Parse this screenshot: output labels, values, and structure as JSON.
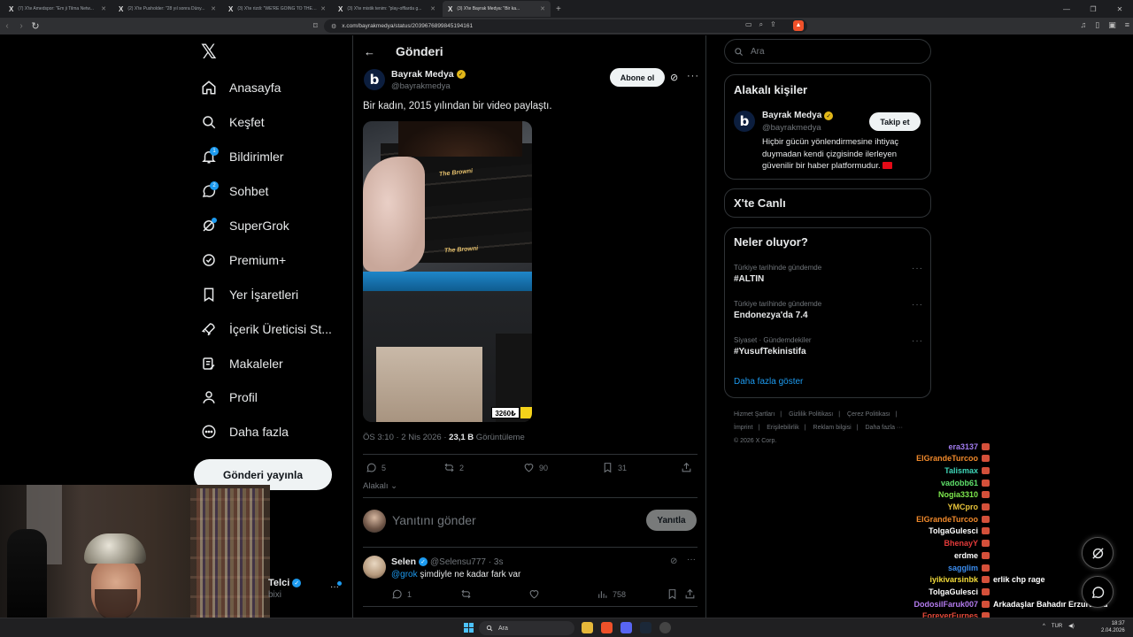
{
  "browser": {
    "tabs": [
      {
        "label": "(7) X'te Amedspor: \"Em ji Tilma Netw..."
      },
      {
        "label": "(2) X'te Pusholder: \"28 yıl sonra Düny..."
      },
      {
        "label": "(3) X'te rizdi: \"WE'RE GOING TO THE W..."
      },
      {
        "label": "(3) X'te mistik tenim: \"play-offlarda g..."
      },
      {
        "label": "(3) X'te Bayrak Medya: \"Bir ka..."
      }
    ],
    "url": "x.com/bayrakmedya/status/2039676899845194161"
  },
  "nav": {
    "items": [
      {
        "label": "Anasayfa",
        "icon": "home-icon"
      },
      {
        "label": "Keşfet",
        "icon": "search-icon"
      },
      {
        "label": "Bildirimler",
        "icon": "bell-icon",
        "badge": "1"
      },
      {
        "label": "Sohbet",
        "icon": "chat-icon",
        "badge": "2"
      },
      {
        "label": "SuperGrok",
        "icon": "grok-icon"
      },
      {
        "label": "Premium+",
        "icon": "premium-icon"
      },
      {
        "label": "Yer İşaretleri",
        "icon": "bookmark-icon"
      },
      {
        "label": "İçerik Üreticisi St...",
        "icon": "rocket-icon"
      },
      {
        "label": "Makaleler",
        "icon": "article-icon"
      },
      {
        "label": "Profil",
        "icon": "person-icon"
      },
      {
        "label": "Daha fazla",
        "icon": "more-circle-icon"
      }
    ],
    "post_button": "Gönderi yayınla",
    "account_name": "Telci",
    "account_handle": "bixi",
    "account_more": "···"
  },
  "header": {
    "back": "←",
    "title": "Gönderi"
  },
  "post": {
    "avatar_letter": "b",
    "author": "Bayrak Medya",
    "handle": "@bayrakmedya",
    "subscribe": "Abone ol",
    "text": "Bir kadın, 2015 yılından bir video paylaştı.",
    "media_texts": [
      "The Browni",
      "The Browni",
      "3260₺"
    ],
    "time": "ÖS 3:10 · 2 Nis 2026 · ",
    "views": "23,1 B",
    "views_label": " Görüntüleme",
    "stats": {
      "replies": "5",
      "reposts": "2",
      "likes": "90",
      "bookmarks": "31"
    },
    "related": "Alakalı",
    "reply_placeholder": "Yanıtını gönder",
    "reply_button": "Yanıtla"
  },
  "comment": {
    "name": "Selen",
    "handle": "@Selensu777 · 3s",
    "mention": "@grok",
    "text": " şimdiyle ne kadar fark var",
    "replies": "1",
    "views": "758"
  },
  "sidebar": {
    "search_placeholder": "Ara",
    "related_title": "Alakalı kişiler",
    "person": {
      "name": "Bayrak Medya",
      "handle": "@bayrakmedya",
      "bio": "Hiçbir gücün yönlendirmesine ihtiyaç duymadan kendi çizgisinde ilerleyen güvenilir bir haber platformudur.",
      "follow": "Takip et"
    },
    "live_title": "X'te Canlı",
    "trends_title": "Neler oluyor?",
    "trends": [
      {
        "context": "Türkiye tarihinde gündemde",
        "name": "#ALTIN"
      },
      {
        "context": "Türkiye tarihinde gündemde",
        "name": "Endonezya'da 7.4"
      },
      {
        "context": "Siyaset · Gündemdekiler",
        "name": "#YusufTekinistifa"
      }
    ],
    "show_more": "Daha fazla göster",
    "footer": [
      "Hizmet Şartları",
      "Gizlilik Politikası",
      "Çerez Politikası",
      "İmprint",
      "Erişilebilirlik",
      "Reklam bilgisi",
      "Daha fazla ···",
      "© 2026 X Corp."
    ]
  },
  "chat": {
    "messages": [
      {
        "name": "era3137",
        "color": "#a27cf0",
        "msg": ""
      },
      {
        "name": "ElGrandeTurcoo",
        "color": "#f0892b",
        "msg": ""
      },
      {
        "name": "Talismax",
        "color": "#3fd6b8",
        "msg": ""
      },
      {
        "name": "vadobb61",
        "color": "#5fe06a",
        "msg": ""
      },
      {
        "name": "Nogia3310",
        "color": "#7ee84d",
        "msg": ""
      },
      {
        "name": "YMCpro",
        "color": "#e7c33a",
        "msg": ""
      },
      {
        "name": "ElGrandeTurcoo",
        "color": "#f0892b",
        "msg": ""
      },
      {
        "name": "TolgaGulesci",
        "color": "#ffffff",
        "msg": ""
      },
      {
        "name": "BhenayY",
        "color": "#e33a3a",
        "msg": ""
      },
      {
        "name": "erdme",
        "color": "#ffffff",
        "msg": ""
      },
      {
        "name": "sagglim",
        "color": "#3b8df0",
        "msg": ""
      },
      {
        "name": "iyikivarsinbk",
        "color": "#f4dc3a",
        "msg": "erlik chp rage"
      },
      {
        "name": "TolgaGulesci",
        "color": "#ffffff",
        "msg": ""
      },
      {
        "name": "DodosilFaruk007",
        "color": "#b57cf0",
        "msg": "Arkadaşlar Bahadır Erzurumlu"
      },
      {
        "name": "ForeverFurnes",
        "color": "#e34a3a",
        "msg": ""
      }
    ]
  },
  "taskbar": {
    "search": "Ara",
    "lang": "TUR",
    "time": "18:37",
    "date": "2.04.2026"
  },
  "colors": {
    "accent": "#1d9bf0",
    "verified_gold": "#e2b719",
    "background": "#000000"
  }
}
